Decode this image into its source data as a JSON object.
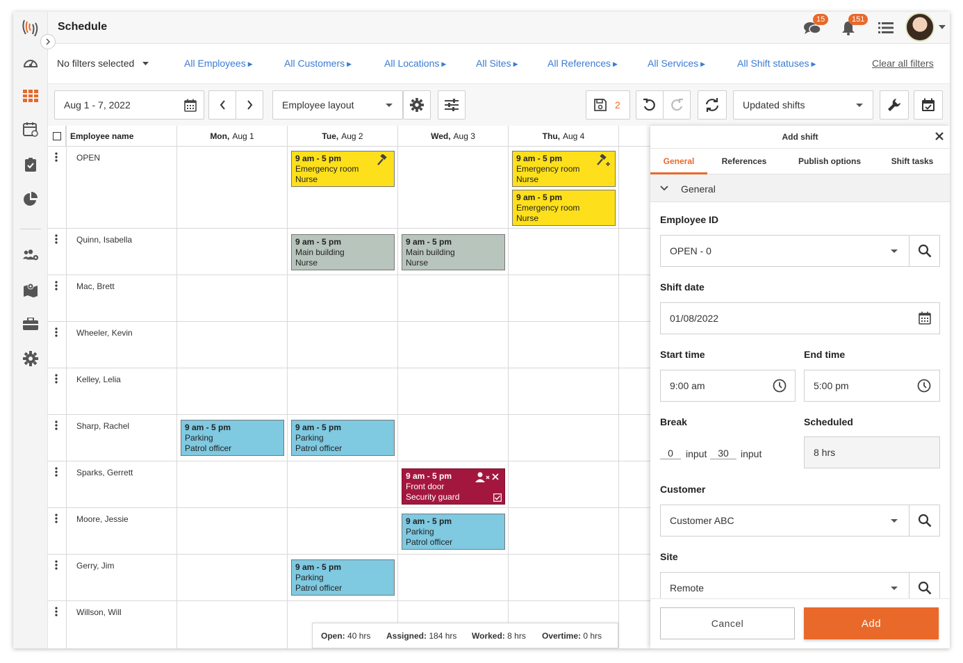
{
  "app": {
    "title": "Schedule",
    "messages_badge": "15",
    "notifications_badge": "151"
  },
  "filters": {
    "none_selected": "No filters selected",
    "employees": "All Employees",
    "customers": "All Customers",
    "locations": "All Locations",
    "sites": "All Sites",
    "references": "All References",
    "services": "All Services",
    "shift_statuses": "All Shift statuses",
    "clear_all": "Clear all filters"
  },
  "toolbar": {
    "date_range": "Aug 1 - 7, 2022",
    "layout": "Employee layout",
    "saved_count": "2",
    "view": "Updated shifts"
  },
  "grid": {
    "employee_header": "Employee name",
    "days": [
      {
        "dow": "Mon,",
        "date": "Aug 1"
      },
      {
        "dow": "Tue,",
        "date": "Aug 2"
      },
      {
        "dow": "Wed,",
        "date": "Aug 3"
      },
      {
        "dow": "Thu,",
        "date": "Aug 4"
      }
    ],
    "employees": [
      "OPEN",
      "Quinn, Isabella",
      "Mac, Brett",
      "Wheeler, Kevin",
      "Kelley, Lelia",
      "Sharp, Rachel",
      "Sparks, Gerrett",
      "Moore, Jessie",
      "Gerry, Jim",
      "Willson, Will"
    ],
    "shifts": [
      {
        "time": "9 am - 5 pm",
        "location": "Emergency room",
        "role": "Nurse"
      },
      {
        "time": "9 am - 5 pm",
        "location": "Emergency room",
        "role": "Nurse"
      },
      {
        "time": "9 am - 5 pm",
        "location": "Emergency room",
        "role": "Nurse"
      },
      {
        "time": "9 am - 5 pm",
        "location": "Main building",
        "role": "Nurse"
      },
      {
        "time": "9 am - 5 pm",
        "location": "Main building",
        "role": "Nurse"
      },
      {
        "time": "9 am - 5 pm",
        "location": "Parking",
        "role": "Patrol officer"
      },
      {
        "time": "9 am - 5 pm",
        "location": "Parking",
        "role": "Patrol officer"
      },
      {
        "time": "9 am - 5 pm",
        "location": "Front door",
        "role": "Security guard"
      },
      {
        "time": "9 am - 5 pm",
        "location": "Parking",
        "role": "Patrol officer"
      },
      {
        "time": "9 am - 5 pm",
        "location": "Parking",
        "role": "Patrol officer"
      }
    ]
  },
  "summary": {
    "open_label": "Open:",
    "open_value": "40 hrs",
    "assigned_label": "Assigned:",
    "assigned_value": "184 hrs",
    "worked_label": "Worked:",
    "worked_value": "8 hrs",
    "overtime_label": "Overtime:",
    "overtime_value": "0 hrs"
  },
  "panel": {
    "title": "Add shift",
    "tabs": [
      "General",
      "References",
      "Publish options",
      "Shift tasks"
    ],
    "section": "General",
    "employee_id_label": "Employee ID",
    "employee_id_value": "OPEN - 0",
    "shift_date_label": "Shift date",
    "shift_date_value": "01/08/2022",
    "start_time_label": "Start time",
    "start_time_value": "9:00 am",
    "end_time_label": "End time",
    "end_time_value": "5:00 pm",
    "break_label": "Break",
    "break_hours": "0",
    "break_hours_unit": "input",
    "break_minutes": "30",
    "break_minutes_unit": "input",
    "scheduled_label": "Scheduled",
    "scheduled_value": "8 hrs",
    "customer_label": "Customer",
    "customer_value": "Customer ABC",
    "site_label": "Site",
    "site_value": "Remote",
    "cancel_label": "Cancel",
    "add_label": "Add"
  },
  "colors": {
    "accent": "#e8692a",
    "link": "#3a7bd5",
    "shift_yellow": "#fde01b",
    "shift_gray": "#b8c5bd",
    "shift_blue": "#7fc9e1",
    "shift_red": "#a3173f"
  },
  "icons": [
    "logo-icon",
    "dashboard-icon",
    "schedule-grid-icon",
    "calendar-icon",
    "clipboard-check-icon",
    "pie-chart-icon",
    "users-gear-icon",
    "map-icon",
    "briefcase-icon",
    "gear-icon",
    "chat-icon",
    "bell-icon",
    "list-icon"
  ]
}
